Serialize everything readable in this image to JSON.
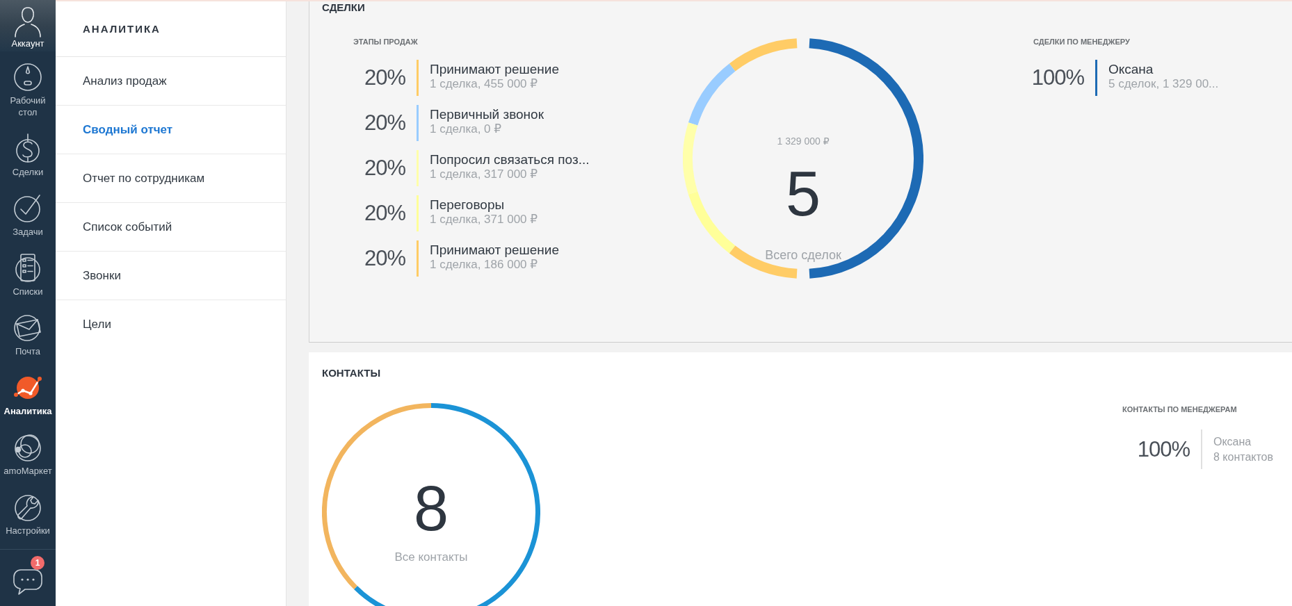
{
  "nav": {
    "account": {
      "label": "Аккаунт"
    },
    "items": [
      {
        "label": "Рабочий стол",
        "selected": false
      },
      {
        "label": "Сделки",
        "selected": false
      },
      {
        "label": "Задачи",
        "selected": false
      },
      {
        "label": "Списки",
        "selected": false
      },
      {
        "label": "Почта",
        "selected": false
      },
      {
        "label": "Аналитика",
        "selected": true
      },
      {
        "label": "amoМаркет",
        "selected": false
      },
      {
        "label": "Настройки",
        "selected": false
      }
    ],
    "chat": {
      "badge": "1"
    }
  },
  "submenu": {
    "title": "АНАЛИТИКА",
    "items": [
      {
        "label": "Анализ продаж",
        "selected": false
      },
      {
        "label": "Сводный отчет",
        "selected": true
      },
      {
        "label": "Отчет по сотрудникам",
        "selected": false
      },
      {
        "label": "Список событий",
        "selected": false
      },
      {
        "label": "Звонки",
        "selected": false
      },
      {
        "label": "Цели",
        "selected": false
      }
    ]
  },
  "deals": {
    "title": "СДЕЛКИ",
    "stages": {
      "title": "ЭТАПЫ ПРОДАЖ",
      "items": [
        {
          "percent": "20%",
          "name": "Принимают решение",
          "detail": "1 сделка, 455 000 ₽",
          "color": "#ffcc66"
        },
        {
          "percent": "20%",
          "name": "Первичный звонок",
          "detail": "1 сделка, 0 ₽",
          "color": "#99ccff"
        },
        {
          "percent": "20%",
          "name": "Попросил связаться поз...",
          "detail": "1 сделка, 317 000 ₽",
          "color": "#ffffaa"
        },
        {
          "percent": "20%",
          "name": "Переговоры",
          "detail": "1 сделка, 371 000 ₽",
          "color": "#ffff99"
        },
        {
          "percent": "20%",
          "name": "Принимают решение",
          "detail": "1 сделка, 186 000 ₽",
          "color": "#ffcc66"
        }
      ]
    },
    "total": {
      "amount": "1 329 000 ₽",
      "count": "5",
      "label": "Всего сделок"
    },
    "managers": {
      "title": "СДЕЛКИ ПО МЕНЕДЖЕРУ",
      "items": [
        {
          "percent": "100%",
          "name": "Оксана",
          "detail": "5 сделок, 1 329 00...",
          "color": "#1d6ab4"
        }
      ]
    }
  },
  "contacts": {
    "title": "КОНТАКТЫ",
    "total": {
      "count": "8",
      "label": "Все контакты"
    },
    "managers": {
      "title": "КОНТАКТЫ ПО МЕНЕДЖЕРАМ",
      "items": [
        {
          "percent": "100%",
          "name": "Оксана",
          "detail": "8 контактов"
        }
      ]
    }
  }
}
